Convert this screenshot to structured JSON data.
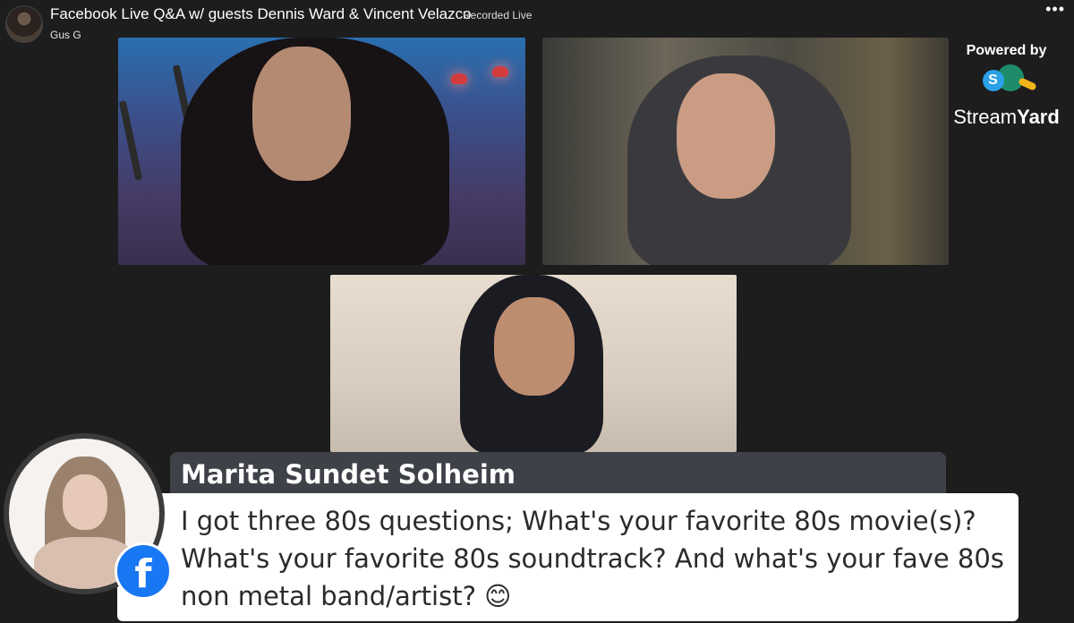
{
  "header": {
    "title": "Facebook Live Q&A w/ guests Dennis Ward & Vincent Velazco",
    "live_label": "Recorded Live",
    "author": "Gus G",
    "more_label": "•••"
  },
  "branding": {
    "powered_by": "Powered by",
    "logo_letter": "S",
    "name_light": "Stream",
    "name_bold": "Yard"
  },
  "comment": {
    "author": "Marita Sundet Solheim",
    "text": "I got three 80s questions; What's your favorite 80s movie(s)? What's your favorite 80s soundtrack? And what's your fave 80s non metal band/artist? 😊",
    "platform_icon": "facebook-icon",
    "platform_letter": "f"
  },
  "colors": {
    "background": "#1d1d1d",
    "name_bar": "#3f4148",
    "facebook_blue": "#1877f2",
    "streamyard_blue": "#2aa0e8"
  }
}
